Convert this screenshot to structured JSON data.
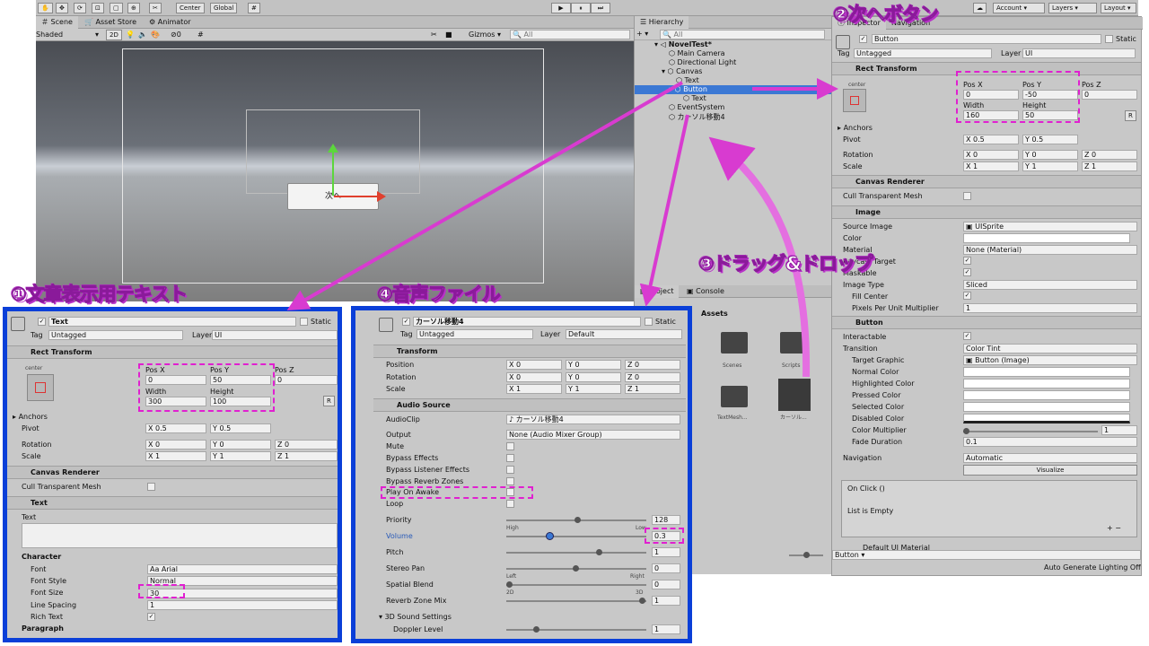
{
  "toolbar": {
    "pivot": "Center",
    "space": "Global",
    "account": "Account",
    "layers": "Layers",
    "layout": "Layout"
  },
  "scene": {
    "tab_scene": "Scene",
    "tab_store": "Asset Store",
    "tab_animator": "Animator",
    "shading": "Shaded",
    "mode2d": "2D",
    "gizmos": "Gizmos",
    "search_ph": "All",
    "button_text": "次へ",
    "vis_count": "0"
  },
  "hierarchy": {
    "title": "Hierarchy",
    "search_ph": "All",
    "scene_name": "NovelTest*",
    "items": [
      "Main Camera",
      "Directional Light",
      "Canvas",
      "Text",
      "Button",
      "Text",
      "EventSystem",
      "カーソル移動4"
    ]
  },
  "project": {
    "tab_project": "Project",
    "tab_console": "Console",
    "assets": "Assets",
    "items": [
      "Scenes",
      "Scripts",
      "TextMesh...",
      "カーソル..."
    ],
    "count": "8"
  },
  "callouts": {
    "c1": "①文章表示用テキスト",
    "c2": "②次へボタン",
    "c3": "③ドラッグ&ドロップ",
    "c4": "④音声ファイル"
  },
  "insp_button": {
    "tab_inspector": "Inspector",
    "tab_navigation": "Navigation",
    "name": "Button",
    "static": "Static",
    "tag_label": "Tag",
    "tag": "Untagged",
    "layer_label": "Layer",
    "layer": "UI",
    "rect": "Rect Transform",
    "anchor_h": "center",
    "anchor_v": "middle",
    "posx_l": "Pos X",
    "posy_l": "Pos Y",
    "posz_l": "Pos Z",
    "posx": "0",
    "posy": "-50",
    "posz": "0",
    "w_l": "Width",
    "h_l": "Height",
    "w": "160",
    "h": "50",
    "r": "R",
    "anchors": "Anchors",
    "pivot": "Pivot",
    "pivx": "0.5",
    "pivy": "0.5",
    "rotation": "Rotation",
    "scale": "Scale",
    "rx": "0",
    "ry": "0",
    "rz": "0",
    "sx": "1",
    "sy": "1",
    "sz": "1",
    "canvas_renderer": "Canvas Renderer",
    "cull": "Cull Transparent Mesh",
    "image": "Image",
    "source_image": "Source Image",
    "sprite": "UISprite",
    "color": "Color",
    "material": "Material",
    "material_val": "None (Material)",
    "raycast": "Raycast Target",
    "maskable": "Maskable",
    "image_type": "Image Type",
    "image_type_val": "Sliced",
    "fill_center": "Fill Center",
    "ppu": "Pixels Per Unit Multiplier",
    "ppu_val": "1",
    "button": "Button",
    "interactable": "Interactable",
    "transition": "Transition",
    "transition_val": "Color Tint",
    "target_graphic": "Target Graphic",
    "target_graphic_val": "Button (Image)",
    "normal": "Normal Color",
    "highlighted": "Highlighted Color",
    "pressed": "Pressed Color",
    "selected": "Selected Color",
    "disabled": "Disabled Color",
    "multiplier": "Color Multiplier",
    "multiplier_val": "1",
    "fade": "Fade Duration",
    "fade_val": "0.1",
    "navigation": "Navigation",
    "navigation_val": "Automatic",
    "visualize": "Visualize",
    "onclick": "On Click ()",
    "list_empty": "List is Empty",
    "material_foot": "Default UI Material",
    "footer_obj": "Button",
    "lighting": "Auto Generate Lighting Off"
  },
  "insp_text": {
    "name": "Text",
    "static": "Static",
    "tag_label": "Tag",
    "tag": "Untagged",
    "layer_label": "Layer",
    "layer": "UI",
    "rect": "Rect Transform",
    "anchor_h": "center",
    "anchor_v": "middle",
    "posx_l": "Pos X",
    "posy_l": "Pos Y",
    "posz_l": "Pos Z",
    "posx": "0",
    "posy": "50",
    "posz": "0",
    "w_l": "Width",
    "h_l": "Height",
    "w": "300",
    "h": "100",
    "r": "R",
    "anchors": "Anchors",
    "pivot": "Pivot",
    "pivx": "0.5",
    "pivy": "0.5",
    "rotation": "Rotation",
    "scale": "Scale",
    "rx": "0",
    "ry": "0",
    "rz": "0",
    "sx": "1",
    "sy": "1",
    "sz": "1",
    "canvas_renderer": "Canvas Renderer",
    "cull": "Cull Transparent Mesh",
    "text_comp": "Text",
    "text_label": "Text",
    "character": "Character",
    "font": "Font",
    "font_val": "Arial",
    "font_style": "Font Style",
    "font_style_val": "Normal",
    "font_size": "Font Size",
    "font_size_val": "30",
    "line_spacing": "Line Spacing",
    "line_spacing_val": "1",
    "rich_text": "Rich Text",
    "paragraph": "Paragraph"
  },
  "insp_audio": {
    "name": "カーソル移動4",
    "static": "Static",
    "tag_label": "Tag",
    "tag": "Untagged",
    "layer_label": "Layer",
    "layer": "Default",
    "transform": "Transform",
    "position": "Position",
    "rotation": "Rotation",
    "scale": "Scale",
    "px": "0",
    "py": "0",
    "pz": "0",
    "rx": "0",
    "ry": "0",
    "rz": "0",
    "sx": "1",
    "sy": "1",
    "sz": "1",
    "audio_source": "Audio Source",
    "audioclip": "AudioClip",
    "audioclip_val": "カーソル移動4",
    "output": "Output",
    "output_val": "None (Audio Mixer Group)",
    "mute": "Mute",
    "bypass_effects": "Bypass Effects",
    "bypass_listener": "Bypass Listener Effects",
    "bypass_reverb": "Bypass Reverb Zones",
    "play_on_awake": "Play On Awake",
    "loop": "Loop",
    "priority": "Priority",
    "priority_val": "128",
    "high": "High",
    "low": "Low",
    "volume": "Volume",
    "volume_val": "0.3",
    "pitch": "Pitch",
    "pitch_val": "1",
    "stereo_pan": "Stereo Pan",
    "stereo_val": "0",
    "left": "Left",
    "right": "Right",
    "spatial": "Spatial Blend",
    "spatial_val": "0",
    "d2": "2D",
    "d3": "3D",
    "reverb_mix": "Reverb Zone Mix",
    "reverb_val": "1",
    "sound3d": "3D Sound Settings",
    "doppler": "Doppler Level",
    "doppler_val": "1"
  }
}
